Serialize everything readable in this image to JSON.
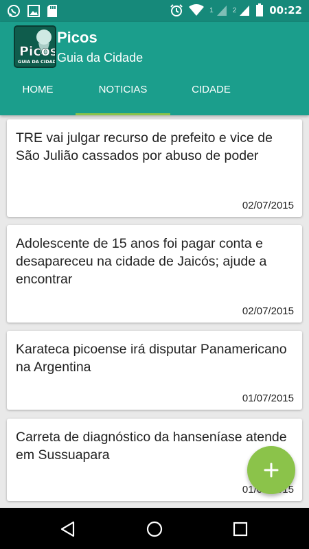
{
  "status_bar": {
    "sim1": "1",
    "sim2": "2",
    "time": "00:22",
    "left_icons": [
      "whatsapp-icon",
      "image-icon",
      "sd-card-icon"
    ],
    "right_icons": [
      "alarm-icon",
      "wifi-icon",
      "signal-icon",
      "battery-icon"
    ]
  },
  "app": {
    "logo_text": "Picos",
    "logo_sub": "GUIA DA CIDADE",
    "title": "Picos",
    "subtitle": "Guia da Cidade"
  },
  "tabs": [
    {
      "label": "HOME",
      "active": false
    },
    {
      "label": "NOTICIAS",
      "active": true
    },
    {
      "label": "CIDADE",
      "active": false
    }
  ],
  "news": [
    {
      "title": "TRE vai julgar recurso de prefeito e vice de São Julião cassados por abuso de poder",
      "date": "02/07/2015"
    },
    {
      "title": "Adolescente de 15 anos foi pagar conta e desapareceu na cidade de Jaicós; ajude a encontrar",
      "date": "02/07/2015"
    },
    {
      "title": "Karateca picoense irá disputar Panamericano na Argentina",
      "date": "01/07/2015"
    },
    {
      "title": "Carreta de diagnóstico da hanseníase atende em Sussuapara",
      "date": "01/07/2015"
    }
  ],
  "fab": {
    "icon": "plus-icon",
    "color": "#8bc34a"
  },
  "colors": {
    "primary": "#1b9e8c",
    "primary_dark": "#16897a",
    "accent": "#8bc34a"
  },
  "navbar": {
    "icons": [
      "back-icon",
      "home-icon",
      "recents-icon"
    ]
  }
}
